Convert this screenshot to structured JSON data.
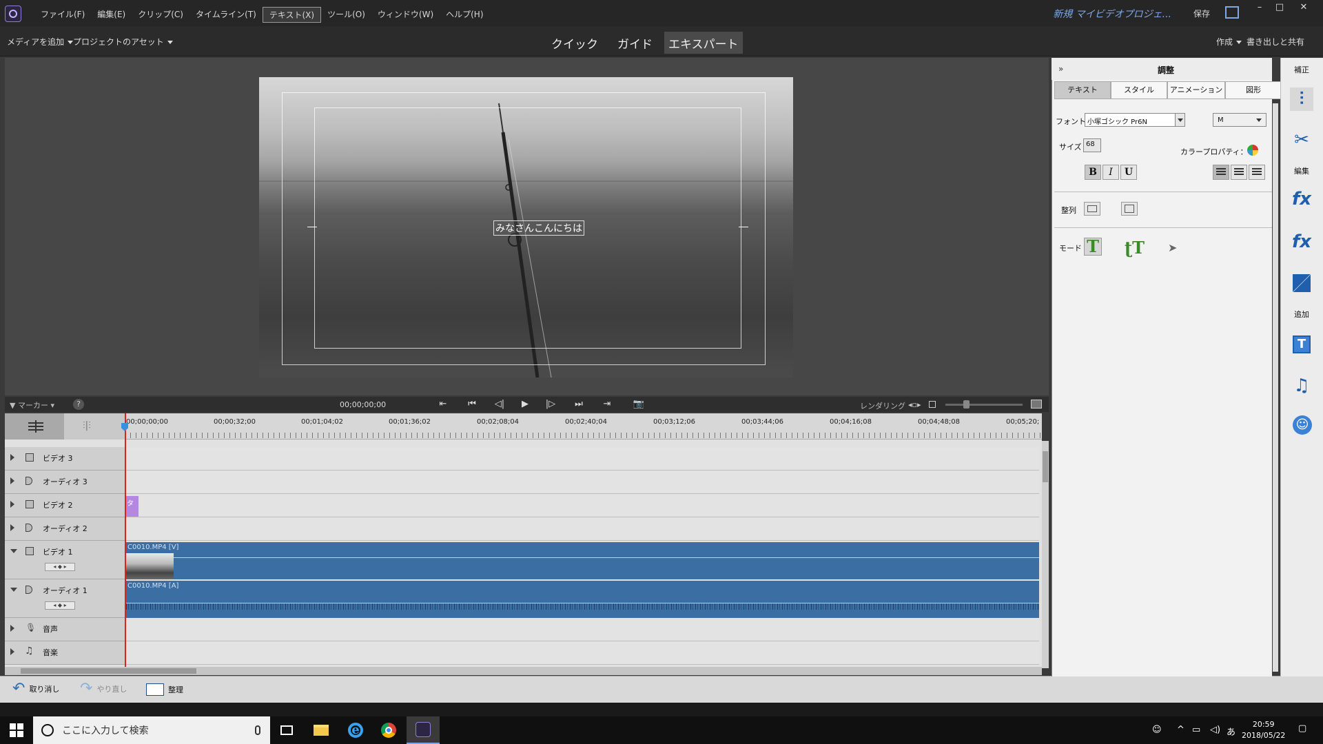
{
  "menubar": {
    "items": [
      "ファイル(F)",
      "編集(E)",
      "クリップ(C)",
      "タイムライン(T)",
      "テキスト(X)",
      "ツール(O)",
      "ウィンドウ(W)",
      "ヘルプ(H)"
    ],
    "project_title": "新規 マイビデオプロジェ...",
    "save": "保存",
    "window_controls": [
      "–",
      "□",
      "✕"
    ]
  },
  "toolbar": {
    "add_media": "メディアを追加",
    "project_assets": "プロジェクトのアセット",
    "modes": [
      "クイック",
      "ガイド",
      "エキスパート"
    ],
    "active_mode": "エキスパート",
    "create": "作成",
    "export_share": "書き出しと共有"
  },
  "monitor": {
    "overlay_text": "みなさんこんにちは"
  },
  "timeline_toolbar": {
    "marker": "マーカー",
    "help": "?",
    "timecode": "00;00;00;00",
    "transport": [
      "⇤",
      "⏮",
      "◁|",
      "▶",
      "|▷",
      "⏭",
      "⇥",
      "📷"
    ],
    "render": "レンダリング"
  },
  "ruler": {
    "labels": [
      "00;00;00;00",
      "00;00;32;00",
      "00;01;04;02",
      "00;01;36;02",
      "00;02;08;04",
      "00;02;40;04",
      "00;03;12;06",
      "00;03;44;06",
      "00;04;16;08",
      "00;04;48;08",
      "00;05;20;"
    ]
  },
  "tracks": [
    {
      "name": "ビデオ 3",
      "type": "video"
    },
    {
      "name": "オーディオ 3",
      "type": "audio"
    },
    {
      "name": "ビデオ 2",
      "type": "video"
    },
    {
      "name": "オーディオ 2",
      "type": "audio"
    },
    {
      "name": "ビデオ 1",
      "type": "video"
    },
    {
      "name": "オーディオ 1",
      "type": "audio"
    },
    {
      "name": "音声",
      "type": "narration"
    },
    {
      "name": "音楽",
      "type": "music"
    }
  ],
  "clips": {
    "title_clip": "タ",
    "video_clip": "C0010.MP4 [V]",
    "audio_clip": "C0010.MP4 [A]"
  },
  "bottombar": {
    "undo": "取り消し",
    "redo": "やり直し",
    "organize": "整理"
  },
  "panel": {
    "title": "調整",
    "tabs": [
      "テキスト",
      "スタイル",
      "アニメーション",
      "図形"
    ],
    "active_tab": "テキスト",
    "font_label": "フォント",
    "font_value": "小塚ゴシック Pr6N",
    "weight_value": "M",
    "size_label": "サイズ",
    "size_value": "68",
    "color_label": "カラープロパティ：",
    "bold": "B",
    "italic": "I",
    "underline": "U",
    "align_label": "整列",
    "mode_label": "モード"
  },
  "strip": {
    "correct": "補正",
    "edit": "編集",
    "add": "追加"
  },
  "taskbar": {
    "search_placeholder": "ここに入力して検索",
    "time": "20:59",
    "date": "2018/05/22",
    "ime": "あ"
  }
}
